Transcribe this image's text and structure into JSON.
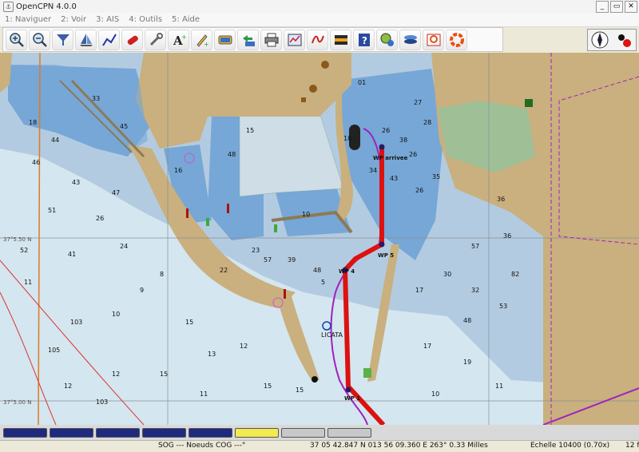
{
  "window": {
    "title": "OpenCPN 4.0.0",
    "buttons": [
      "_",
      "▭",
      "✕"
    ]
  },
  "menu": [
    {
      "label": "1: Naviguer"
    },
    {
      "label": "2: Voir"
    },
    {
      "label": "3: AIS"
    },
    {
      "label": "4: Outils"
    },
    {
      "label": "5: Aide"
    }
  ],
  "toolbar": [
    "zoom-in-icon",
    "zoom-out-icon",
    "scale-icon",
    "chart-quilt-icon",
    "route-icon",
    "track-icon",
    "settings-icon",
    "text-icon",
    "mark-icon",
    "chart-icon",
    "chart-toggle-icon",
    "print-icon",
    "route-manager-icon",
    "tide-icon",
    "current-icon",
    "help-icon",
    "ais-icon",
    "layers-icon",
    "mob-icon",
    "lifebuoy-icon"
  ],
  "map": {
    "latitude_labels": [
      "37°5.50 N",
      "37°5.00 N"
    ],
    "waypoints": [
      "WP arrivee",
      "WP 5",
      "WP 4",
      "WP 1"
    ],
    "port": "LICATA",
    "depths_deep": [
      "01",
      "18",
      "26",
      "38",
      "34",
      "43",
      "27",
      "28",
      "26",
      "35",
      "26",
      "36",
      "57",
      "36",
      "18",
      "33",
      "44",
      "45",
      "48",
      "15",
      "16",
      "10"
    ],
    "depths_shallow": [
      "46",
      "43",
      "47",
      "51",
      "26",
      "52",
      "41",
      "24",
      "23",
      "39",
      "48",
      "30",
      "17",
      "32",
      "82",
      "53",
      "5",
      "22",
      "57",
      "48"
    ],
    "depths_open": [
      "11",
      "103",
      "10",
      "9",
      "8",
      "105",
      "15",
      "13",
      "12",
      "15",
      "15",
      "15",
      "12",
      "17",
      "19",
      "11",
      "10",
      "103",
      "12",
      "11"
    ],
    "colors": {
      "land": "#c9b07e",
      "deep": "#76a7d6",
      "shallow": "#b3cbe0",
      "open": "#d4e6ef",
      "route": "#dd1111",
      "track": "#a021c0"
    }
  },
  "pianobar": {
    "keys": [
      "nav",
      "nav",
      "nav",
      "nav",
      "nav",
      "yellow",
      "grey",
      "grey"
    ]
  },
  "status": {
    "sog": "SOG --- Noeuds COG ---°",
    "position": "37 05 42.847 N   013 56 09.360 E 263°  0.33 Milles",
    "scale": "Echelle 10400 (0.70x)",
    "zoom": "12 f"
  }
}
